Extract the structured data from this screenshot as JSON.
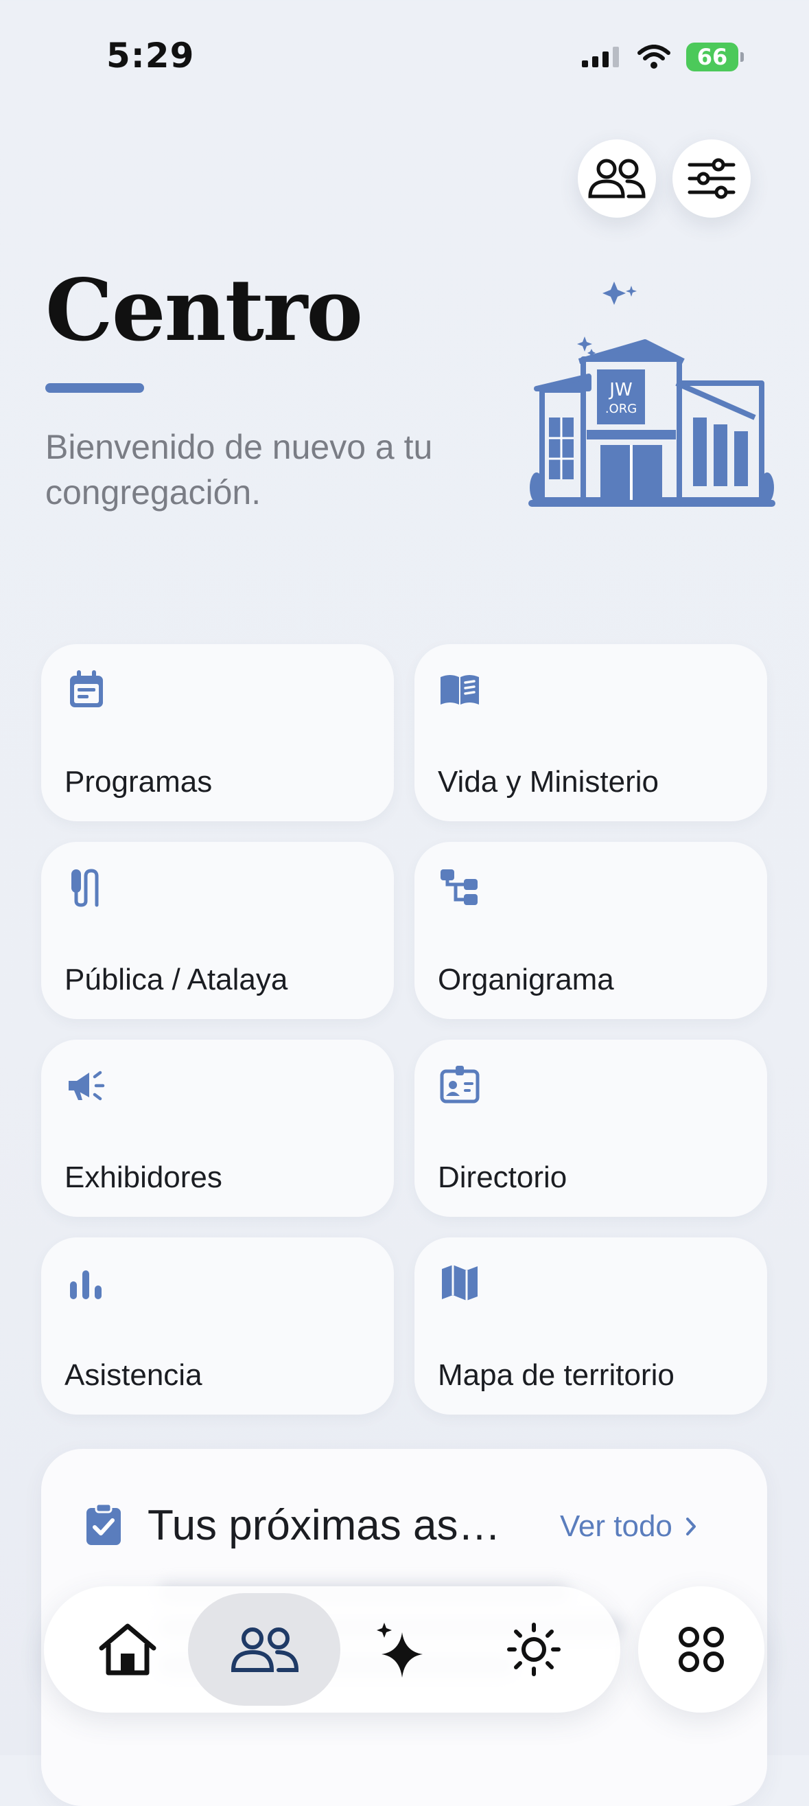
{
  "status_bar": {
    "time": "5:29",
    "battery": "66"
  },
  "header": {
    "title": "Centro",
    "subtitle": "Bienvenido de nuevo a tu congregación.",
    "illustration_text_top": "JW",
    "illustration_text_bottom": ".ORG"
  },
  "top_buttons": [
    {
      "icon": "people-icon"
    },
    {
      "icon": "sliders-icon"
    }
  ],
  "menu": {
    "items": [
      {
        "label": "Programas",
        "icon": "calendar-icon"
      },
      {
        "label": "Vida y Ministerio",
        "icon": "book-icon"
      },
      {
        "label": "Pública / Atalaya",
        "icon": "microphone-icon"
      },
      {
        "label": "Organigrama",
        "icon": "org-chart-icon"
      },
      {
        "label": "Exhibidores",
        "icon": "megaphone-icon"
      },
      {
        "label": "Directorio",
        "icon": "id-badge-icon"
      },
      {
        "label": "Asistencia",
        "icon": "bar-chart-icon"
      },
      {
        "label": "Mapa de territorio",
        "icon": "map-icon"
      }
    ]
  },
  "assignments": {
    "title": "Tus próximas asig...",
    "link": "Ver todo"
  },
  "tab_bar": {
    "tabs": [
      {
        "icon": "home-icon",
        "active": false
      },
      {
        "icon": "people-icon",
        "active": true
      },
      {
        "icon": "sparkle-icon",
        "active": false
      },
      {
        "icon": "sun-icon",
        "active": false
      }
    ],
    "more_icon": "grid-icon"
  },
  "colors": {
    "accent": "#5a7dbd",
    "text": "#1b1d22",
    "muted": "#7a7d85",
    "battery": "#4cc95a"
  }
}
